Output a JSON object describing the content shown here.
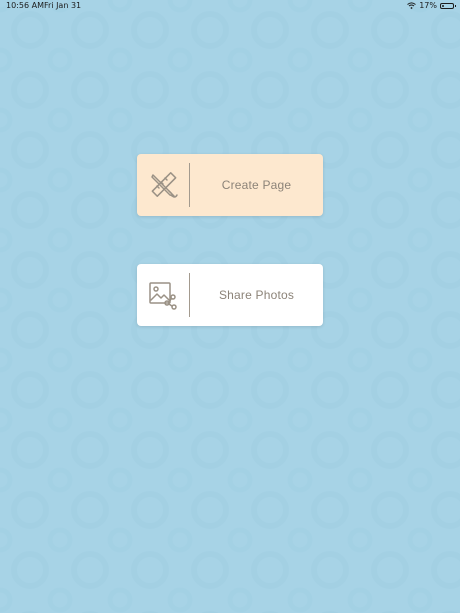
{
  "status_bar": {
    "time": "10:56 AM",
    "date": "Fri Jan 31",
    "battery_percent": "17%",
    "battery_level": 0.17,
    "wifi_icon": "wifi-icon"
  },
  "actions": {
    "create_page": {
      "label": "Create Page",
      "icon": "pencil-ruler-icon",
      "background": "#fde8cf"
    },
    "share_photos": {
      "label": "Share Photos",
      "icon": "image-share-icon",
      "background": "#ffffff"
    }
  },
  "colors": {
    "background": "#a7d3e6",
    "label_text": "#8c8378",
    "icon_stroke": "#9a9185"
  }
}
